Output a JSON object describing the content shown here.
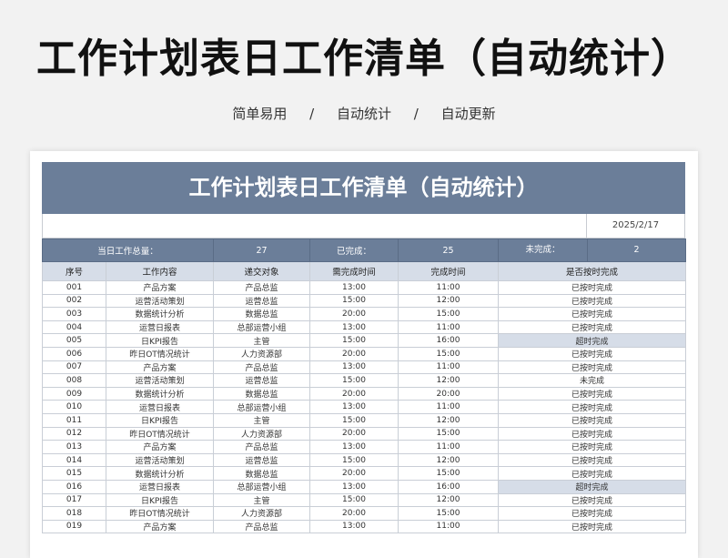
{
  "page": {
    "title": "工作计划表日工作清单（自动统计）",
    "features": [
      "简单易用",
      "自动统计",
      "自动更新"
    ],
    "separator": "/"
  },
  "sheet": {
    "title": "工作计划表日工作清单（自动统计）",
    "date": "2025/2/17",
    "summary": {
      "total_label": "当日工作总量：",
      "total_value": "27",
      "done_label": "已完成：",
      "done_value": "25",
      "undone_label": "未完成：",
      "undone_value": "2"
    },
    "columns": [
      "序号",
      "工作内容",
      "递交对象",
      "需完成时间",
      "完成时间",
      "是否按时完成"
    ],
    "rows": [
      [
        "001",
        "产品方案",
        "产品总监",
        "13:00",
        "11:00",
        "已按时完成"
      ],
      [
        "002",
        "运营活动策划",
        "运营总监",
        "15:00",
        "12:00",
        "已按时完成"
      ],
      [
        "003",
        "数据统计分析",
        "数据总监",
        "20:00",
        "15:00",
        "已按时完成"
      ],
      [
        "004",
        "运营日报表",
        "总部运营小组",
        "13:00",
        "11:00",
        "已按时完成"
      ],
      [
        "005",
        "日KPI报告",
        "主管",
        "15:00",
        "16:00",
        "超时完成"
      ],
      [
        "006",
        "昨日OT情况统计",
        "人力资源部",
        "20:00",
        "15:00",
        "已按时完成"
      ],
      [
        "007",
        "产品方案",
        "产品总监",
        "13:00",
        "11:00",
        "已按时完成"
      ],
      [
        "008",
        "运营活动策划",
        "运营总监",
        "15:00",
        "12:00",
        "未完成"
      ],
      [
        "009",
        "数据统计分析",
        "数据总监",
        "20:00",
        "20:00",
        "已按时完成"
      ],
      [
        "010",
        "运营日报表",
        "总部运营小组",
        "13:00",
        "11:00",
        "已按时完成"
      ],
      [
        "011",
        "日KPI报告",
        "主管",
        "15:00",
        "12:00",
        "已按时完成"
      ],
      [
        "012",
        "昨日OT情况统计",
        "人力资源部",
        "20:00",
        "15:00",
        "已按时完成"
      ],
      [
        "013",
        "产品方案",
        "产品总监",
        "13:00",
        "11:00",
        "已按时完成"
      ],
      [
        "014",
        "运营活动策划",
        "运营总监",
        "15:00",
        "12:00",
        "已按时完成"
      ],
      [
        "015",
        "数据统计分析",
        "数据总监",
        "20:00",
        "15:00",
        "已按时完成"
      ],
      [
        "016",
        "运营日报表",
        "总部运营小组",
        "13:00",
        "16:00",
        "超时完成"
      ],
      [
        "017",
        "日KPI报告",
        "主管",
        "15:00",
        "12:00",
        "已按时完成"
      ],
      [
        "018",
        "昨日OT情况统计",
        "人力资源部",
        "20:00",
        "15:00",
        "已按时完成"
      ],
      [
        "019",
        "产品方案",
        "产品总监",
        "13:00",
        "11:00",
        "已按时完成"
      ]
    ]
  },
  "colors": {
    "header_bg": "#6b7e99",
    "column_header_bg": "#d6dde8",
    "late_bg": "#d6dde8",
    "undone_text": "#c0392b"
  }
}
